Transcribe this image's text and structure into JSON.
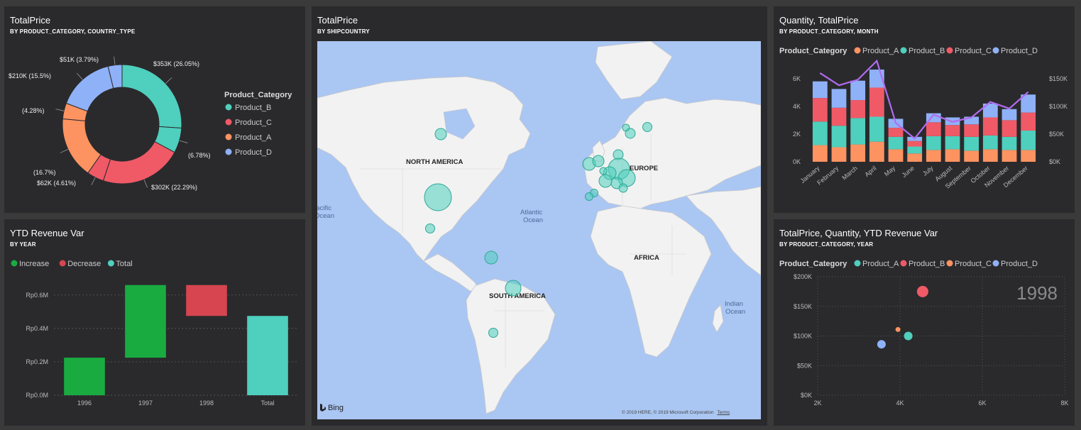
{
  "tiles": {
    "donut": {
      "title": "TotalPrice",
      "subtitle": "BY PRODUCT_CATEGORY, COUNTRY_TYPE"
    },
    "map": {
      "title": "TotalPrice",
      "subtitle": "BY SHIPCOUNTRY"
    },
    "combo": {
      "title": "Quantity, TotalPrice",
      "subtitle": "BY PRODUCT_CATEGORY, MONTH"
    },
    "waterfall": {
      "title": "YTD Revenue Var",
      "subtitle": "BY YEAR"
    },
    "scatter": {
      "title": "TotalPrice, Quantity, YTD Revenue Var",
      "subtitle": "BY PRODUCT_CATEGORY, YEAR"
    }
  },
  "map": {
    "labels": [
      "NORTH AMERICA",
      "EUROPE",
      "SOUTH AMERICA",
      "AFRICA",
      "Atlantic",
      "Ocean",
      "Pacific",
      "Ocean",
      "Indian",
      "Ocean"
    ],
    "brand": "Bing",
    "copyright": "© 2019 HERE, © 2019 Microsoft Corporation",
    "terms": "Terms"
  },
  "chart_data": [
    {
      "type": "pie",
      "variant": "donut",
      "legend_title": "Product_Category",
      "legend_position": "right",
      "categories": [
        "Product_B",
        "Product_C",
        "Product_A",
        "Product_D"
      ],
      "colors": {
        "Product_A": "#fd9361",
        "Product_B": "#4fcfbd",
        "Product_C": "#ef5a66",
        "Product_D": "#8fb1f7"
      },
      "slices": [
        {
          "category": "Product_B",
          "value": 26.05,
          "label": "$353K (26.05%)"
        },
        {
          "category": "Product_B",
          "value": 6.78,
          "label": "(6.78%)"
        },
        {
          "category": "Product_C",
          "value": 22.29,
          "label": "$302K (22.29%)"
        },
        {
          "category": "Product_C",
          "value": 4.61,
          "label": "$62K (4.61%)"
        },
        {
          "category": "Product_A",
          "value": 16.7,
          "label": "(16.7%)"
        },
        {
          "category": "Product_A",
          "value": 4.28,
          "label": "(4.28%)"
        },
        {
          "category": "Product_D",
          "value": 15.5,
          "label": "$210K (15.5%)"
        },
        {
          "category": "Product_D",
          "value": 3.79,
          "label": "$51K (3.79%)"
        }
      ]
    },
    {
      "type": "bar",
      "variant": "stacked-column-with-line",
      "legend_title": "Product_Category",
      "legend_position": "top",
      "categories": [
        "January",
        "February",
        "March",
        "April",
        "May",
        "June",
        "July",
        "August",
        "September",
        "October",
        "November",
        "December"
      ],
      "series": [
        {
          "name": "Product_A",
          "color": "#fd9361",
          "values": [
            1200,
            1050,
            1250,
            1450,
            900,
            600,
            850,
            900,
            800,
            900,
            850,
            850
          ]
        },
        {
          "name": "Product_B",
          "color": "#4fcfbd",
          "values": [
            1700,
            1550,
            1900,
            1800,
            900,
            500,
            1000,
            950,
            1000,
            1000,
            950,
            1400
          ]
        },
        {
          "name": "Product_C",
          "color": "#ef5a66",
          "values": [
            1700,
            1300,
            1300,
            2100,
            650,
            400,
            1000,
            800,
            900,
            1300,
            1200,
            1300
          ]
        },
        {
          "name": "Product_D",
          "color": "#8fb1f7",
          "values": [
            1200,
            1350,
            1400,
            1300,
            650,
            300,
            650,
            550,
            550,
            1000,
            800,
            1300
          ]
        }
      ],
      "line": {
        "color": "#b26bf0",
        "values": [
          160000,
          138000,
          148000,
          182000,
          70000,
          42000,
          85000,
          72000,
          80000,
          108000,
          96000,
          126000
        ]
      },
      "yticks_left": [
        "0K",
        "2K",
        "4K",
        "6K"
      ],
      "yticks_right": [
        "$0K",
        "$50K",
        "$100K",
        "$150K"
      ],
      "ylim_left": [
        0,
        6500
      ],
      "ylim_right": [
        0,
        162500
      ]
    },
    {
      "type": "bar",
      "variant": "waterfall",
      "legend": [
        "Increase",
        "Decrease",
        "Total"
      ],
      "legend_position": "top",
      "colors": {
        "Increase": "#1aab40",
        "Decrease": "#d64550",
        "Total": "#4fcfbd"
      },
      "categories": [
        "1996",
        "1997",
        "1998",
        "Total"
      ],
      "steps": [
        {
          "category": "1996",
          "kind": "Increase",
          "start": 0,
          "end": 0.225
        },
        {
          "category": "1997",
          "kind": "Increase",
          "start": 0.225,
          "end": 0.66
        },
        {
          "category": "1998",
          "kind": "Decrease",
          "start": 0.66,
          "end": 0.475
        },
        {
          "category": "Total",
          "kind": "Total",
          "start": 0,
          "end": 0.475
        }
      ],
      "yticks": [
        "Rp0.0M",
        "Rp0.2M",
        "Rp0.4M",
        "Rp0.6M"
      ],
      "ylim": [
        0,
        0.68
      ],
      "grid": true
    },
    {
      "type": "scatter",
      "legend_title": "Product_Category",
      "legend_position": "top",
      "play_label": "1998",
      "points": [
        {
          "name": "Product_A",
          "color": "#4fcfbd",
          "x": 4200,
          "y": 100000,
          "size": "medium"
        },
        {
          "name": "Product_B",
          "color": "#ef5a66",
          "x": 4550,
          "y": 175000,
          "size": "large"
        },
        {
          "name": "Product_C",
          "color": "#fd9361",
          "x": 3950,
          "y": 111000,
          "size": "small"
        },
        {
          "name": "Product_D",
          "color": "#8fb1f7",
          "x": 3550,
          "y": 86000,
          "size": "medium"
        }
      ],
      "xticks": [
        "2K",
        "4K",
        "6K",
        "8K"
      ],
      "yticks": [
        "$0K",
        "$50K",
        "$100K",
        "$150K",
        "$200K"
      ],
      "xlim": [
        2000,
        8000
      ],
      "ylim": [
        0,
        200000
      ],
      "grid": true
    }
  ]
}
